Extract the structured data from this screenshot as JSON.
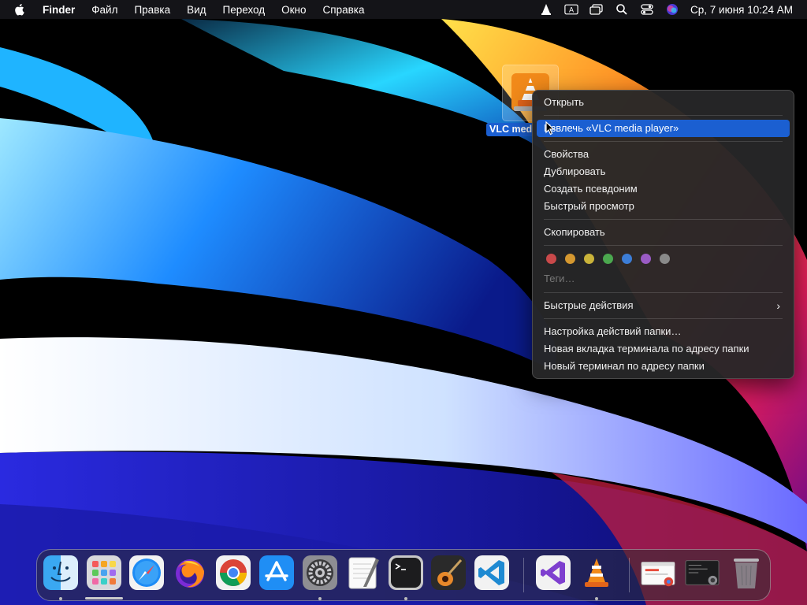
{
  "menubar": {
    "app_name": "Finder",
    "items": [
      "Файл",
      "Правка",
      "Вид",
      "Переход",
      "Окно",
      "Справка"
    ],
    "clock": "Ср, 7 июня  10:24 AM",
    "status_icons": [
      "vlc-icon",
      "keyboard-input-icon",
      "screen-mirror-icon",
      "search-icon",
      "control-center-icon",
      "siri-icon"
    ]
  },
  "desktop": {
    "icon_label": "VLC med",
    "icon_name": "vlc-disk-image-icon"
  },
  "context_menu": {
    "open": "Открыть",
    "eject": "Извлечь «VLC media player»",
    "get_info": "Свойства",
    "duplicate": "Дублировать",
    "make_alias": "Создать псевдоним",
    "quick_look": "Быстрый просмотр",
    "copy": "Скопировать",
    "tag_colors": [
      "#c9494a",
      "#d59830",
      "#c9b33a",
      "#4ba84f",
      "#3c7dd6",
      "#9a5bc4",
      "#8a8a8a"
    ],
    "tags_placeholder": "Теги…",
    "quick_actions": "Быстрые действия",
    "folder_actions_setup": "Настройка действий папки…",
    "new_terminal_tab": "Новая вкладка терминала по адресу папки",
    "new_terminal": "Новый терминал по адресу папки",
    "highlight_color": "#1b5fd1"
  },
  "dock": {
    "apps": [
      "finder-icon",
      "launchpad-icon",
      "safari-icon",
      "firefox-icon",
      "chrome-icon",
      "app-store-icon",
      "system-preferences-icon",
      "textedit-icon",
      "terminal-icon",
      "garageband-icon",
      "vscode-icon",
      "visual-studio-icon",
      "vlc-icon",
      "chrome-window-thumbnail",
      "terminal-window-thumbnail",
      "trash-icon"
    ]
  }
}
